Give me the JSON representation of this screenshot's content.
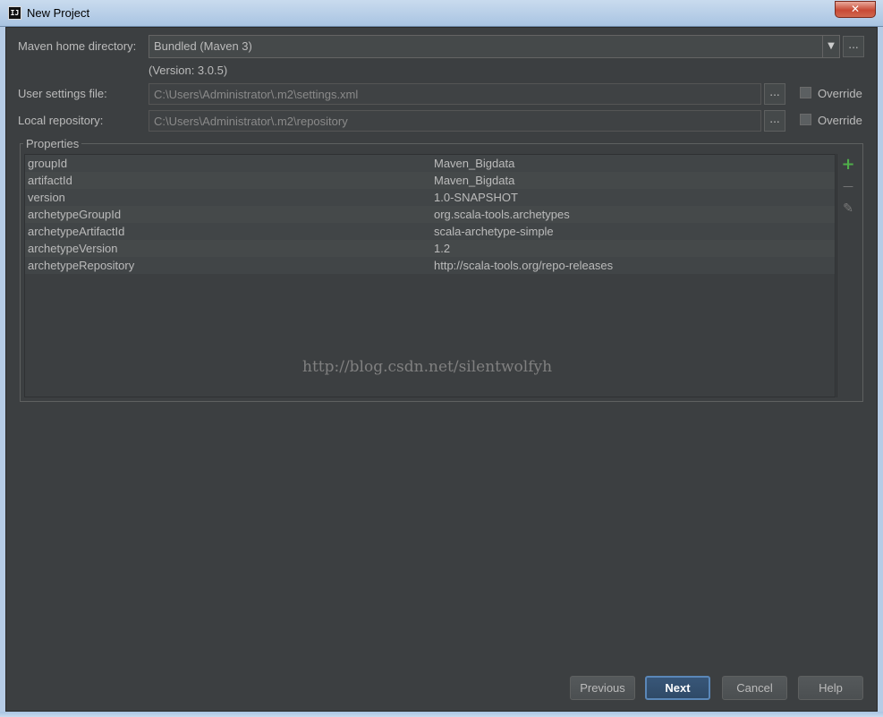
{
  "window": {
    "title": "New Project",
    "app_icon_text": "IJ",
    "close_glyph": "✕"
  },
  "maven_home": {
    "label": "Maven home directory:",
    "value": "Bundled (Maven 3)",
    "version_note": "(Version: 3.0.5)",
    "browse": "..."
  },
  "user_settings": {
    "label": "User settings file:",
    "value": "C:\\Users\\Administrator\\.m2\\settings.xml",
    "browse": "...",
    "override_label": "Override"
  },
  "local_repo": {
    "label": "Local repository:",
    "value": "C:\\Users\\Administrator\\.m2\\repository",
    "browse": "...",
    "override_label": "Override"
  },
  "properties": {
    "title": "Properties",
    "rows": [
      {
        "key": "groupId",
        "value": "Maven_Bigdata"
      },
      {
        "key": "artifactId",
        "value": "Maven_Bigdata"
      },
      {
        "key": "version",
        "value": "1.0-SNAPSHOT"
      },
      {
        "key": "archetypeGroupId",
        "value": "org.scala-tools.archetypes"
      },
      {
        "key": "archetypeArtifactId",
        "value": "scala-archetype-simple"
      },
      {
        "key": "archetypeVersion",
        "value": "1.2"
      },
      {
        "key": "archetypeRepository",
        "value": "http://scala-tools.org/repo-releases"
      }
    ],
    "tools": {
      "add": "+",
      "remove": "—",
      "edit": "✎"
    },
    "colors": {
      "add": "#4fae4a",
      "muted": "#7a7a7a"
    }
  },
  "watermark": "http://blog.csdn.net/silentwolfyh",
  "buttons": {
    "previous": "Previous",
    "next": "Next",
    "cancel": "Cancel",
    "help": "Help"
  }
}
